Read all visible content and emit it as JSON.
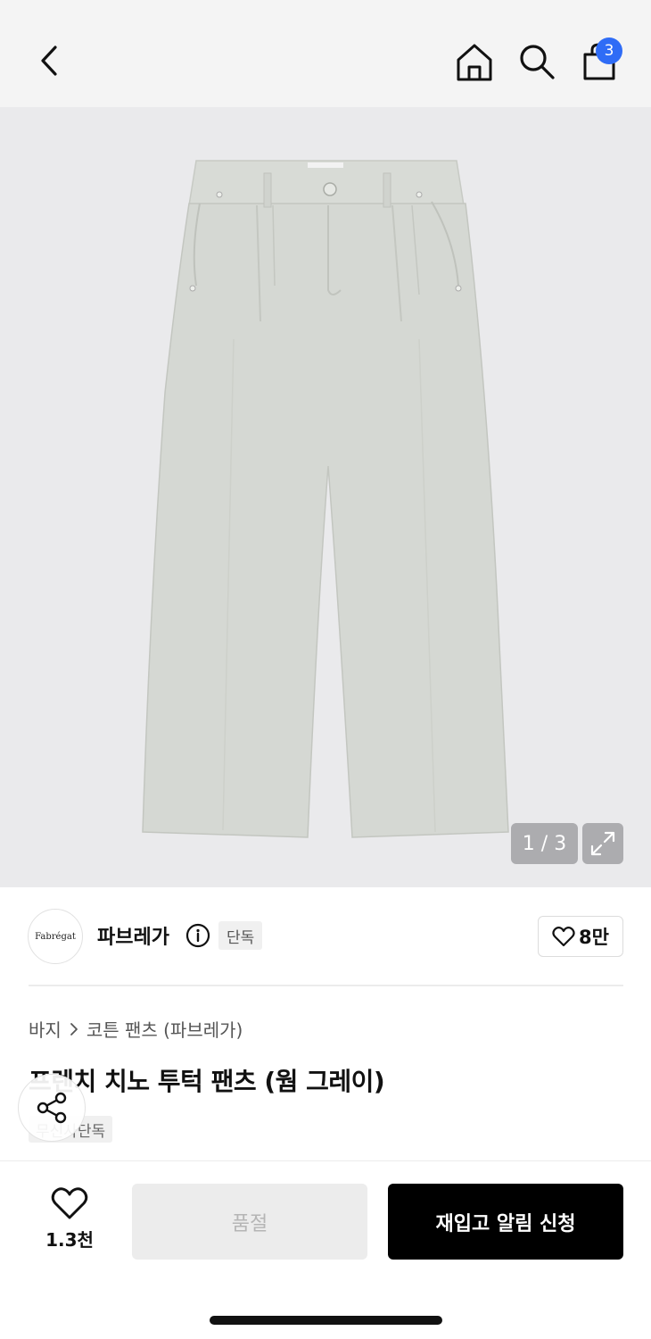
{
  "header": {
    "back_icon": "chevron-left-icon",
    "home_icon": "home-icon",
    "search_icon": "search-icon",
    "bag_icon": "shopping-bag-icon",
    "cart_count": "3",
    "badge_color": "#2f6cf6"
  },
  "gallery": {
    "counter": "1 / 3",
    "expand_icon": "expand-icon",
    "background_color": "#eaeaec",
    "product_color": "#d5d8d3"
  },
  "brand": {
    "logo_text": "Fabrégat",
    "name": "파브레가",
    "info_icon": "info-icon",
    "exclusive_tag": "단독",
    "like_count": "8만"
  },
  "product": {
    "breadcrumb": [
      "바지",
      "코튼 팬츠 (파브레가)"
    ],
    "title": "프렌치 치노 투턱 팬츠 (웜 그레이)",
    "tag": "무신사단독",
    "share_icon": "share-icon"
  },
  "actions": {
    "wish_count": "1.3천",
    "soldout_label": "품절",
    "restock_label": "재입고 알림 신청"
  }
}
